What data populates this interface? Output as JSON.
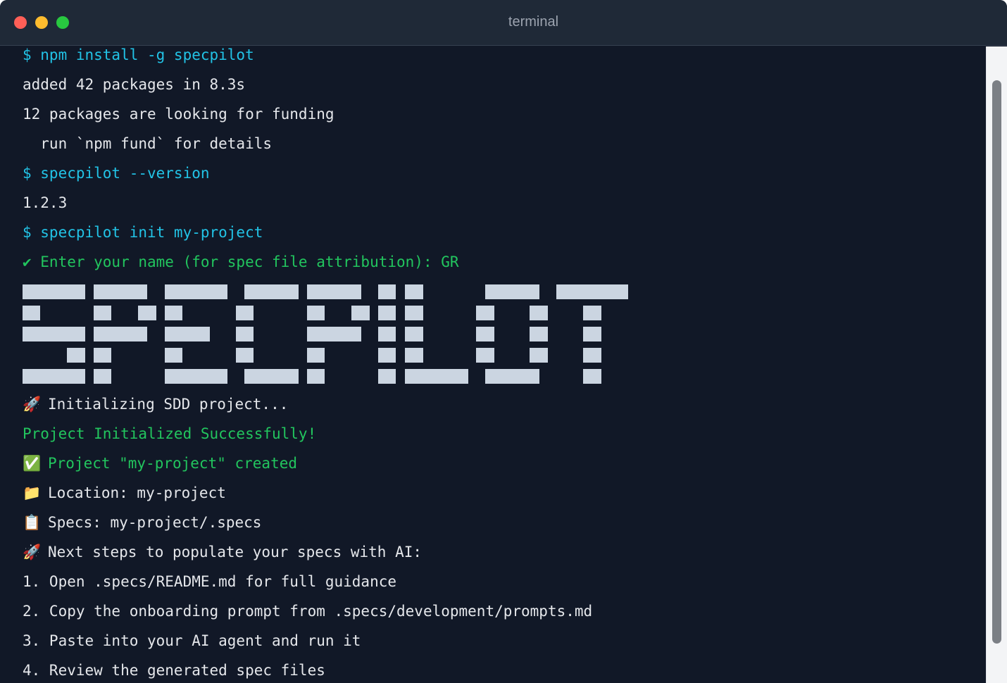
{
  "window": {
    "title": "terminal",
    "controls": {
      "close_color": "#ff5f57",
      "minimize_color": "#febc2e",
      "maximize_color": "#28c840"
    }
  },
  "colors": {
    "background": "#111827",
    "command": "#22c3e6",
    "output": "#e5e7eb",
    "success": "#22c55e",
    "banner": "#cbd5e1"
  },
  "lines": {
    "l1": "$ npm install -g specpilot",
    "l2": "added 42 packages in 8.3s",
    "l3": "12 packages are looking for funding",
    "l4": "  run `npm fund` for details",
    "l5": "$ specpilot --version",
    "l6": "1.2.3",
    "l7": "$ specpilot init my-project",
    "l8": "✔ Enter your name (for spec file attribution): GR",
    "l9": "Initializing SDD project...",
    "l10": "Project Initialized Successfully!",
    "l11": "Project \"my-project\" created",
    "l12": "Location: my-project",
    "l13": "Specs: my-project/.specs",
    "l14": "Next steps to populate your specs with AI:",
    "l15": "1. Open .specs/README.md for full guidance",
    "l16": "2. Copy the onboarding prompt from .specs/development/prompts.md",
    "l17": "3. Paste into your AI agent and run it",
    "l18": "4. Review the generated spec files"
  },
  "icons": {
    "rocket": "🚀",
    "check": "✅",
    "folder": "📁",
    "clipboard": "📋"
  },
  "banner": {
    "text": "SPECPILOT"
  }
}
